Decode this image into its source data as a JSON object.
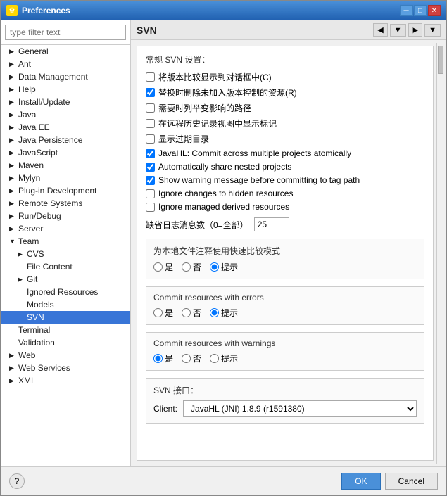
{
  "window": {
    "title": "Preferences",
    "titlebar_icon": "⚙"
  },
  "sidebar": {
    "filter_placeholder": "type filter text",
    "items": [
      {
        "id": "general",
        "label": "General",
        "level": 0,
        "has_arrow": true,
        "arrow": "▶"
      },
      {
        "id": "ant",
        "label": "Ant",
        "level": 0,
        "has_arrow": true,
        "arrow": "▶"
      },
      {
        "id": "data-management",
        "label": "Data Management",
        "level": 0,
        "has_arrow": true,
        "arrow": "▶"
      },
      {
        "id": "help",
        "label": "Help",
        "level": 0,
        "has_arrow": true,
        "arrow": "▶"
      },
      {
        "id": "install-update",
        "label": "Install/Update",
        "level": 0,
        "has_arrow": true,
        "arrow": "▶"
      },
      {
        "id": "java",
        "label": "Java",
        "level": 0,
        "has_arrow": true,
        "arrow": "▶"
      },
      {
        "id": "java-ee",
        "label": "Java EE",
        "level": 0,
        "has_arrow": true,
        "arrow": "▶"
      },
      {
        "id": "java-persistence",
        "label": "Java Persistence",
        "level": 0,
        "has_arrow": true,
        "arrow": "▶"
      },
      {
        "id": "javascript",
        "label": "JavaScript",
        "level": 0,
        "has_arrow": true,
        "arrow": "▶"
      },
      {
        "id": "maven",
        "label": "Maven",
        "level": 0,
        "has_arrow": true,
        "arrow": "▶"
      },
      {
        "id": "mylyn",
        "label": "Mylyn",
        "level": 0,
        "has_arrow": true,
        "arrow": "▶"
      },
      {
        "id": "plugin-development",
        "label": "Plug-in Development",
        "level": 0,
        "has_arrow": true,
        "arrow": "▶"
      },
      {
        "id": "remote-systems",
        "label": "Remote Systems",
        "level": 0,
        "has_arrow": true,
        "arrow": "▶"
      },
      {
        "id": "run-debug",
        "label": "Run/Debug",
        "level": 0,
        "has_arrow": true,
        "arrow": "▶"
      },
      {
        "id": "server",
        "label": "Server",
        "level": 0,
        "has_arrow": true,
        "arrow": "▶"
      },
      {
        "id": "team",
        "label": "Team",
        "level": 0,
        "has_arrow": true,
        "arrow": "▼",
        "expanded": true
      },
      {
        "id": "cvs",
        "label": "CVS",
        "level": 1,
        "has_arrow": true,
        "arrow": "▶"
      },
      {
        "id": "file-content",
        "label": "File Content",
        "level": 1,
        "has_arrow": false,
        "arrow": ""
      },
      {
        "id": "git",
        "label": "Git",
        "level": 1,
        "has_arrow": true,
        "arrow": "▶"
      },
      {
        "id": "ignored-resources",
        "label": "Ignored Resources",
        "level": 1,
        "has_arrow": false,
        "arrow": ""
      },
      {
        "id": "models",
        "label": "Models",
        "level": 1,
        "has_arrow": false,
        "arrow": ""
      },
      {
        "id": "svn",
        "label": "SVN",
        "level": 1,
        "has_arrow": false,
        "arrow": "",
        "selected": true
      },
      {
        "id": "terminal",
        "label": "Terminal",
        "level": 0,
        "has_arrow": false,
        "arrow": ""
      },
      {
        "id": "validation",
        "label": "Validation",
        "level": 0,
        "has_arrow": false,
        "arrow": ""
      },
      {
        "id": "web",
        "label": "Web",
        "level": 0,
        "has_arrow": true,
        "arrow": "▶"
      },
      {
        "id": "web-services",
        "label": "Web Services",
        "level": 0,
        "has_arrow": true,
        "arrow": "▶"
      },
      {
        "id": "xml",
        "label": "XML",
        "level": 0,
        "has_arrow": true,
        "arrow": "▶"
      }
    ]
  },
  "main": {
    "title": "SVN",
    "section_title": "常规 SVN 设置：",
    "checkboxes": [
      {
        "id": "show-compare",
        "label": "将版本比较显示到对话框中(C)",
        "checked": false
      },
      {
        "id": "replace-unversioned",
        "label": "替换时删除未加入版本控制的资源(R)",
        "checked": true
      },
      {
        "id": "list-affected",
        "label": "需要时列举变影响的路径",
        "checked": false
      },
      {
        "id": "show-in-history",
        "label": "在远程历史记录视图中显示标记",
        "checked": false
      },
      {
        "id": "show-date",
        "label": "显示过期目录",
        "checked": false
      },
      {
        "id": "commit-atomic",
        "label": "JavaHL: Commit across multiple projects atomically",
        "checked": true
      },
      {
        "id": "auto-share",
        "label": "Automatically share nested projects",
        "checked": true
      },
      {
        "id": "show-warning",
        "label": "Show warning message before committing to tag path",
        "checked": true
      },
      {
        "id": "ignore-hidden",
        "label": "Ignore changes to hidden resources",
        "checked": false
      },
      {
        "id": "ignore-managed",
        "label": "Ignore managed derived resources",
        "checked": false
      }
    ],
    "log_count_label": "缺省日志消息数（0=全部）",
    "log_count_value": "25",
    "compare_mode_section": {
      "title": "为本地文件注释使用快速比较模式",
      "options": [
        {
          "id": "compare-yes",
          "label": "是",
          "value": "yes"
        },
        {
          "id": "compare-no",
          "label": "否",
          "value": "no"
        },
        {
          "id": "compare-prompt",
          "label": "提示",
          "value": "prompt",
          "selected": true
        }
      ]
    },
    "commit_errors_section": {
      "title": "Commit resources with errors",
      "options": [
        {
          "id": "errors-yes",
          "label": "是",
          "value": "yes"
        },
        {
          "id": "errors-no",
          "label": "否",
          "value": "no"
        },
        {
          "id": "errors-prompt",
          "label": "提示",
          "value": "prompt",
          "selected": true
        }
      ]
    },
    "commit_warnings_section": {
      "title": "Commit resources with warnings",
      "options": [
        {
          "id": "warnings-yes",
          "label": "是",
          "value": "yes",
          "selected": true
        },
        {
          "id": "warnings-no",
          "label": "否",
          "value": "no"
        },
        {
          "id": "warnings-prompt",
          "label": "提示",
          "value": "prompt"
        }
      ]
    },
    "svn_interface_section": {
      "title": "SVN 接口：",
      "client_label": "Client:",
      "client_options": [
        {
          "value": "javahl-jni",
          "label": "JavaHL (JNI) 1.8.9 (r1591380)",
          "selected": true
        }
      ]
    }
  },
  "footer": {
    "help_label": "?",
    "ok_label": "OK",
    "cancel_label": "Cancel"
  },
  "nav": {
    "back_icon": "◀",
    "forward_icon": "▶",
    "dropdown_icon": "▼"
  }
}
